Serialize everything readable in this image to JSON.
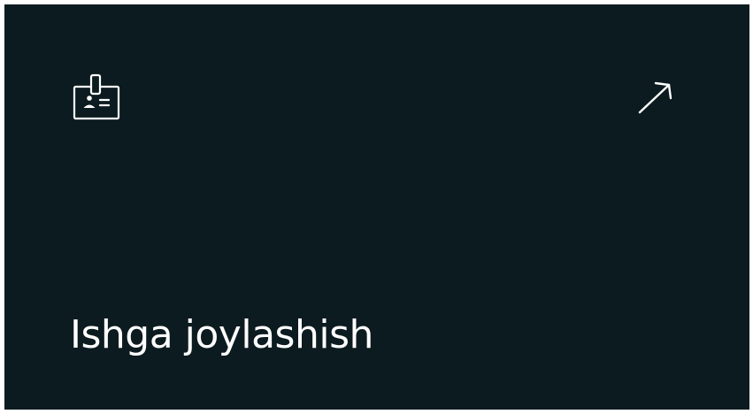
{
  "card": {
    "title": "Ishga joylashish",
    "leading_icon": "id-badge-icon",
    "trailing_icon": "arrow-up-right-icon",
    "background_color": "#0c1b20",
    "text_color": "#ffffff"
  }
}
